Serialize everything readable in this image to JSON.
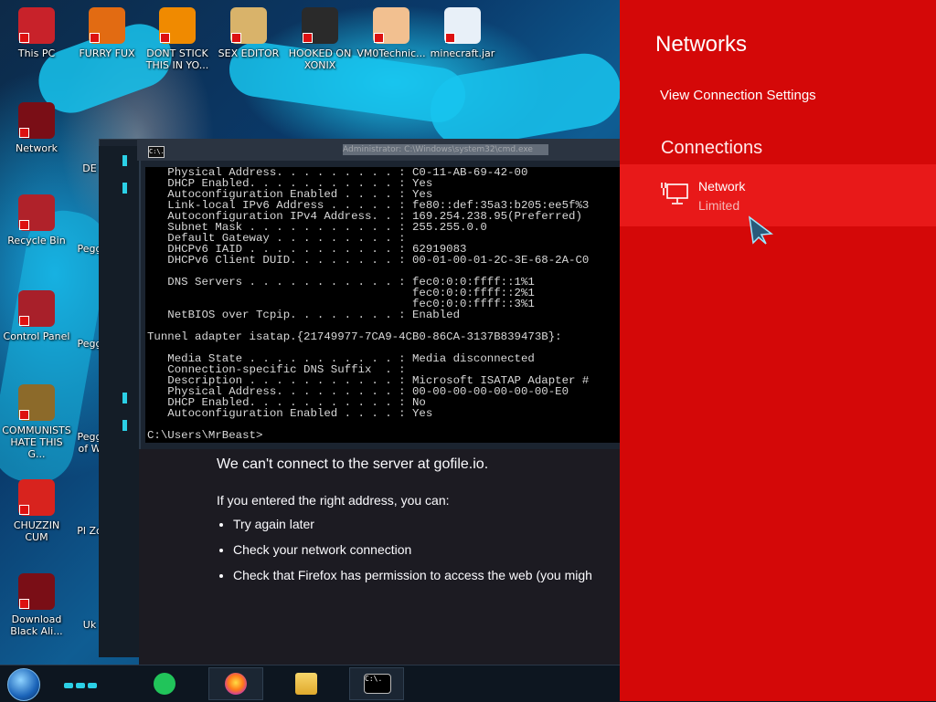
{
  "desktop": {
    "icons": [
      {
        "label": "This PC",
        "color": "#c8222a"
      },
      {
        "label": "FURRY FUX",
        "color": "#e26b12"
      },
      {
        "label": "DONT STICK THIS IN YO...",
        "color": "#f08a00"
      },
      {
        "label": "SEX EDITOR",
        "color": "#d9b36a"
      },
      {
        "label": "HOOKED ON XONIX",
        "color": "#2a2a2a"
      },
      {
        "label": "VM0Technic...",
        "color": "#f2c090"
      },
      {
        "label": "minecraft.jar",
        "color": "#e8f0f8"
      },
      {
        "label": "Network",
        "color": "#7a0e16"
      },
      {
        "label": "Recycle Bin",
        "color": "#b0222a"
      },
      {
        "label": "Control Panel",
        "color": "#a8202a"
      },
      {
        "label": "COMMUNISTS HATE THIS G...",
        "color": "#8c6a2a"
      },
      {
        "label": "CHUZZIN CUM",
        "color": "#d8231e"
      },
      {
        "label": "Download Black Ali...",
        "color": "#7a0e16"
      }
    ],
    "partial_labels": [
      "DE",
      "Pegg",
      "Pegg",
      "Pegg of W",
      "Pl Zo",
      "Uk"
    ]
  },
  "cmd": {
    "title": "Administrator: C:\\Windows\\system32\\cmd.exe",
    "icon_text": "C:\\.",
    "lines": [
      "   Physical Address. . . . . . . . . : C0-11-AB-69-42-00",
      "   DHCP Enabled. . . . . . . . . . . : Yes",
      "   Autoconfiguration Enabled . . . . : Yes",
      "   Link-local IPv6 Address . . . . . : fe80::def:35a3:b205:ee5f%3",
      "   Autoconfiguration IPv4 Address. . : 169.254.238.95(Preferred)",
      "   Subnet Mask . . . . . . . . . . . : 255.255.0.0",
      "   Default Gateway . . . . . . . . . :",
      "   DHCPv6 IAID . . . . . . . . . . . : 62919083",
      "   DHCPv6 Client DUID. . . . . . . . : 00-01-00-01-2C-3E-68-2A-C0",
      "",
      "   DNS Servers . . . . . . . . . . . : fec0:0:0:ffff::1%1",
      "                                       fec0:0:0:ffff::2%1",
      "                                       fec0:0:0:ffff::3%1",
      "   NetBIOS over Tcpip. . . . . . . . : Enabled",
      "",
      "Tunnel adapter isatap.{21749977-7CA9-4CB0-86CA-3137B839473B}:",
      "",
      "   Media State . . . . . . . . . . . : Media disconnected",
      "   Connection-specific DNS Suffix  . :",
      "   Description . . . . . . . . . . . : Microsoft ISATAP Adapter #",
      "   Physical Address. . . . . . . . . : 00-00-00-00-00-00-00-E0",
      "   DHCP Enabled. . . . . . . . . . . : No",
      "   Autoconfiguration Enabled . . . . : Yes",
      "",
      "C:\\Users\\MrBeast>"
    ]
  },
  "firefox_error": {
    "heading": "We can't connect to the server at gofile.io.",
    "subheading": "If you entered the right address, you can:",
    "bullets": [
      "Try again later",
      "Check your network connection",
      "Check that Firefox has permission to access the web (you migh"
    ]
  },
  "flyout": {
    "title": "Networks",
    "settings_link": "View Connection Settings",
    "section": "Connections",
    "network": {
      "name": "Network",
      "status": "Limited"
    },
    "bg_color": "#d40808",
    "highlight_color": "#e81919"
  }
}
